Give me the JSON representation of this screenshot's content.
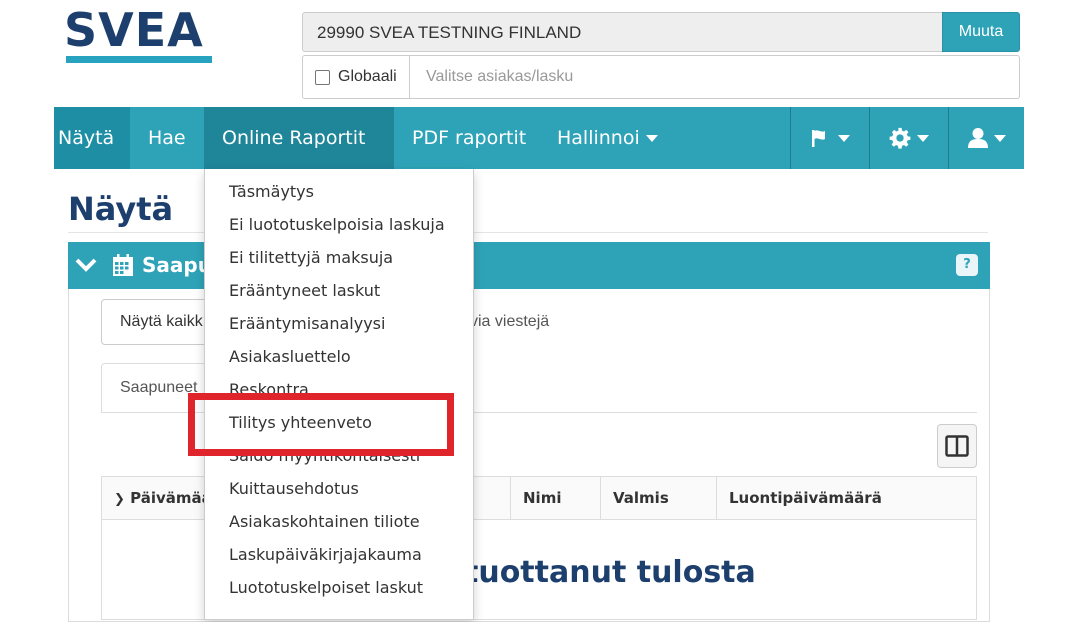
{
  "logo": {
    "text": "SVEA"
  },
  "customer": {
    "name": "29990 SVEA TESTNING FINLAND",
    "change_label": "Muuta"
  },
  "search": {
    "global_label": "Globaali",
    "global_checked": false,
    "placeholder": "Valitse asiakas/lasku"
  },
  "nav": {
    "items": [
      {
        "label": "Näytä"
      },
      {
        "label": "Hae"
      },
      {
        "label": "Online Raportit"
      },
      {
        "label": "PDF raportit"
      },
      {
        "label": "Hallinnoi"
      }
    ],
    "icons": [
      "flag-icon",
      "gear-icon",
      "user-icon"
    ]
  },
  "dropdown": {
    "items": [
      "Täsmäytys",
      "Ei luototuskelpoisia laskuja",
      "Ei tilitettyjä maksuja",
      "Erääntyneet laskut",
      "Erääntymisanalyysi",
      "Asiakasluettelo",
      "Reskontra",
      "Tilitys yhteenveto",
      "Saldo myyntikohtaisesti",
      "Kuittausehdotus",
      "Asiakaskohtainen tiliote",
      "Laskupäiväkirjajakauma",
      "Luototuskelpoiset laskut"
    ],
    "highlighted": "Tilitys yhteenveto"
  },
  "page": {
    "title": "Näytä",
    "panel_title": "Saapu",
    "filter_label": "Näytä kaikk",
    "filter_suffix": "via viestejä",
    "tab_label": "Saapuneet",
    "columns": [
      "Päivämää",
      "Nimi",
      "Valmis",
      "Luontipäivämäärä"
    ],
    "empty_message": "tuottanut tulosta"
  },
  "colors": {
    "brand_dark": "#1d3f6e",
    "accent": "#2ea3b8",
    "highlight": "#e0242b"
  }
}
